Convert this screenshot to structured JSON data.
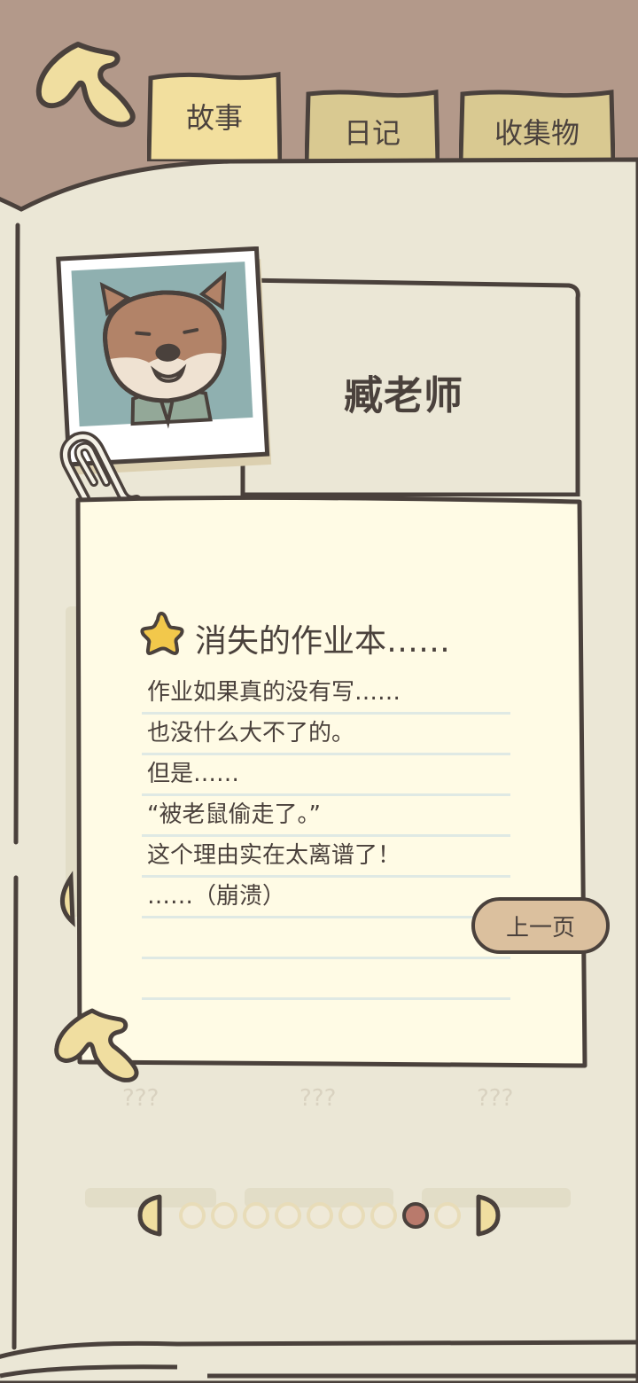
{
  "tabs": {
    "story": "故事",
    "diary": "日记",
    "collection": "收集物"
  },
  "character": {
    "name": "臧老师"
  },
  "story": {
    "title": "消失的作业本……",
    "lines": [
      "作业如果真的没有写……",
      "也没什么大不了的。",
      "但是……",
      "“被老鼠偷走了。”",
      "这个理由实在太离谱了！",
      "……（崩溃）",
      "",
      ""
    ]
  },
  "buttons": {
    "prev_page": "上一页"
  },
  "locked_items": [
    "???",
    "???",
    "???"
  ],
  "pager": {
    "total": 9,
    "current": 8
  },
  "colors": {
    "background": "#b3998a",
    "page": "#ebe7d6",
    "note": "#fffbe5",
    "tab_active": "#f2df9e",
    "tab_inactive": "#d9c991",
    "ink": "#4a413c",
    "accent": "#b97a6c"
  },
  "icons": {
    "back": "curved-back-arrow-icon",
    "star": "star-icon",
    "clip": "paperclip-icon",
    "prev": "half-moon-left-icon",
    "next": "half-moon-right-icon"
  }
}
